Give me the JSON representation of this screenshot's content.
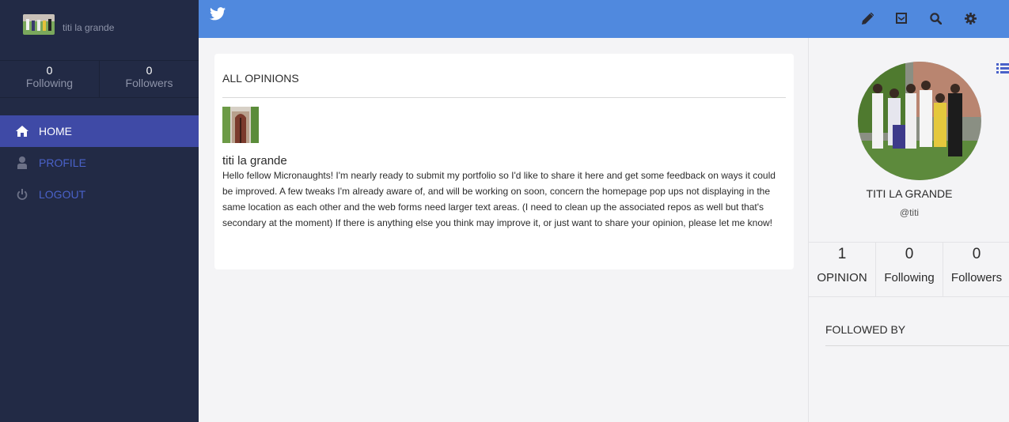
{
  "sidebar": {
    "user_name": "titi la grande",
    "stats": [
      {
        "count": "0",
        "label": "Following"
      },
      {
        "count": "0",
        "label": "Followers"
      }
    ],
    "nav": [
      {
        "label": "HOME",
        "icon": "home-icon"
      },
      {
        "label": "PROFILE",
        "icon": "user-icon"
      },
      {
        "label": "LOGOUT",
        "icon": "power-icon"
      }
    ]
  },
  "topbar": {
    "brand_icon": "twitter-icon",
    "actions": [
      "pencil-icon",
      "inbox-icon",
      "search-icon",
      "gear-icon"
    ]
  },
  "feed": {
    "title": "ALL OPINIONS",
    "opinions": [
      {
        "author": "titi la grande",
        "text": "Hello fellow Micronaughts! I'm nearly ready to submit my portfolio so I'd like to share it here and get some feedback on ways it could be improved. A few tweaks I'm already aware of, and will be working on soon, concern the homepage pop ups not displaying in the same location as each other and the web forms need larger text areas. (I need to clean up the associated repos as well but that's secondary at the moment) If there is anything else you think may improve it, or just want to share your opinion, please let me know!"
      }
    ]
  },
  "profile": {
    "name": "TITI LA GRANDE",
    "handle": "@titi",
    "stats": [
      {
        "count": "1",
        "label": "OPINION"
      },
      {
        "count": "0",
        "label": "Following"
      },
      {
        "count": "0",
        "label": "Followers"
      }
    ],
    "followed_by_title": "FOLLOWED BY"
  },
  "colors": {
    "sidebar": "#222a45",
    "topbar": "#5089de",
    "nav_active": "#3f4aa6",
    "nav_link": "#4a62c9"
  }
}
